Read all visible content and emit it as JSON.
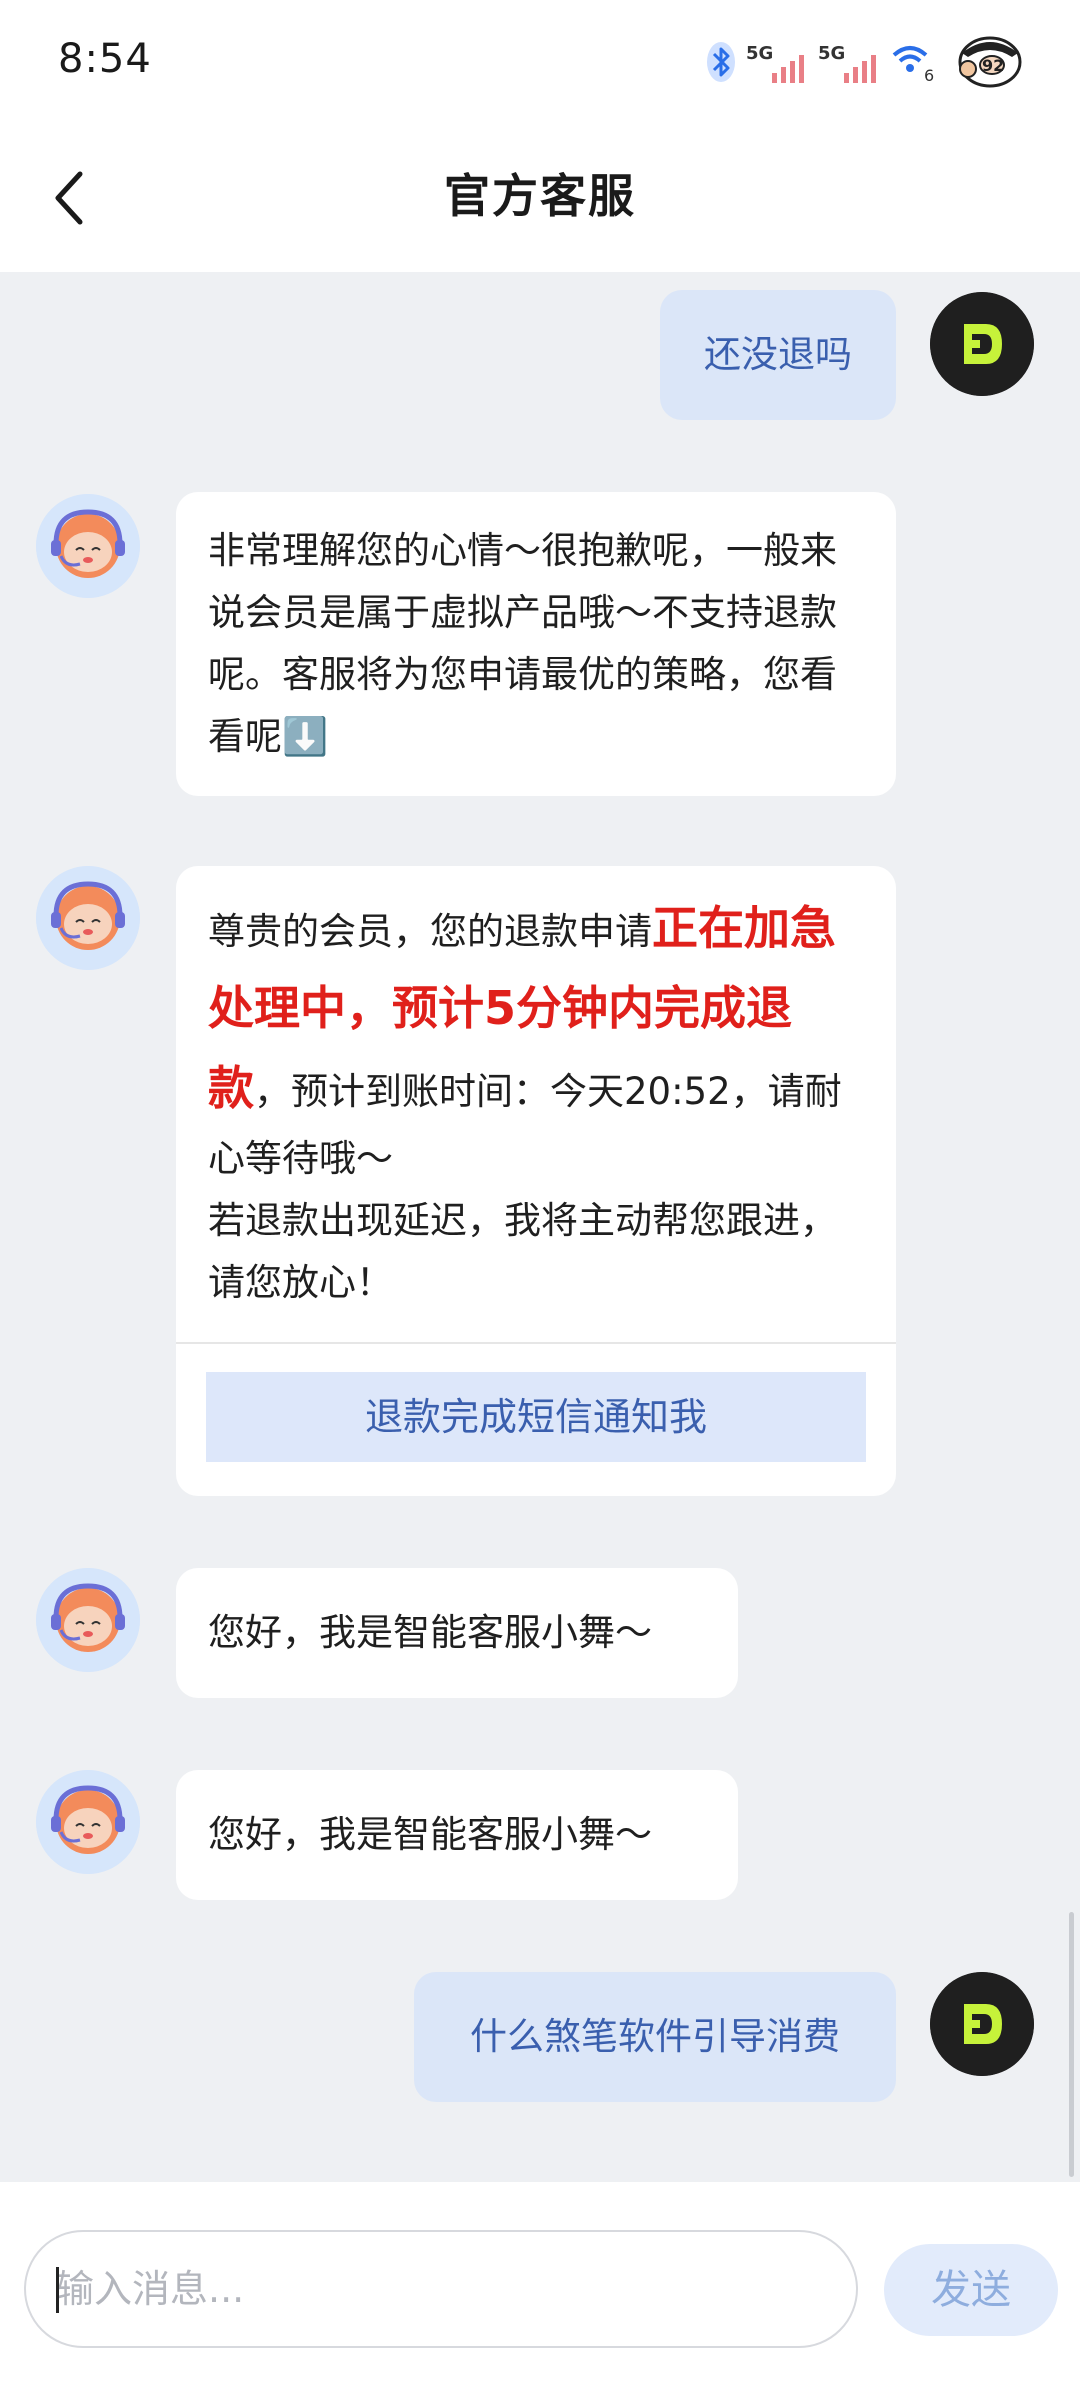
{
  "status_bar": {
    "time": "8:54",
    "network_1": "5G",
    "network_2": "5G",
    "wifi_label": "6"
  },
  "header": {
    "title": "官方客服"
  },
  "messages": [
    {
      "sender": "user",
      "text": "还没退吗"
    },
    {
      "sender": "bot",
      "text": "非常理解您的心情～很抱歉呢，一般来说会员是属于虚拟产品哦～不支持退款呢。客服将为您申请最优的策略，您看看呢⬇️"
    },
    {
      "sender": "bot",
      "prefix": "尊贵的会员，您的退款申请",
      "highlight": "正在加急处理中，预计5分钟内完成退款",
      "suffix": "，预计到账时间：今天20:52，请耐心等待哦～",
      "line2": "若退款出现延迟，我将主动帮您跟进，请您放心！",
      "button": "退款完成短信通知我"
    },
    {
      "sender": "bot",
      "text": "您好，我是智能客服小舞～"
    },
    {
      "sender": "bot",
      "text": "您好，我是智能客服小舞～"
    },
    {
      "sender": "user",
      "text": "什么煞笔软件引导消费"
    }
  ],
  "input": {
    "placeholder": "输入消息...",
    "send_label": "发送"
  },
  "colors": {
    "chat_background": "#eef0f3",
    "user_bubble": "#dbe6f8",
    "user_text": "#3a5fae",
    "highlight_red": "#e0201b",
    "brand_green": "#c6f23a"
  }
}
